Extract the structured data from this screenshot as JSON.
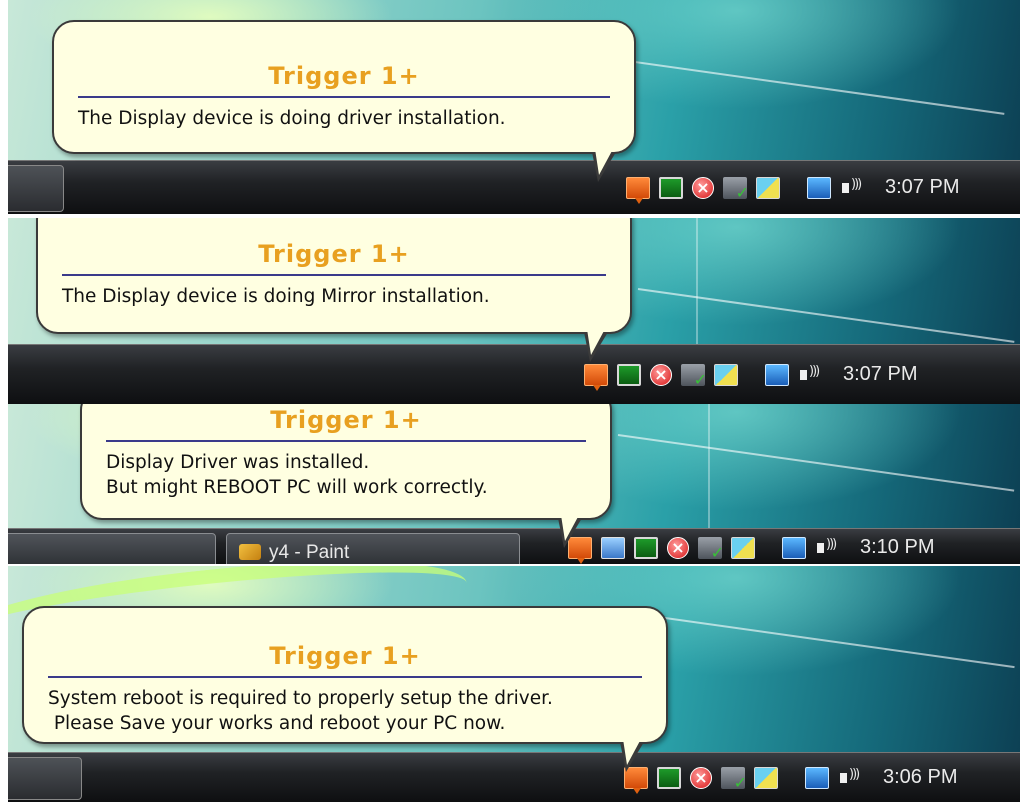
{
  "panels": [
    {
      "balloon": {
        "title": "Trigger 1+",
        "message": "The Display device is doing driver installation."
      },
      "taskbar": {
        "clock": "3:07 PM"
      }
    },
    {
      "balloon": {
        "title": "Trigger 1+",
        "message": "The Display device is doing Mirror installation."
      },
      "taskbar": {
        "clock": "3:07 PM"
      }
    },
    {
      "balloon": {
        "title": "Trigger 1+",
        "message": "Display Driver was installed.\nBut might REBOOT PC will work correctly."
      },
      "taskbar": {
        "clock": "3:10 PM",
        "task_button": "y4 - Paint"
      }
    },
    {
      "balloon": {
        "title": "Trigger 1+",
        "message": "System reboot is required to properly setup the driver.\n Please Save your works and reboot your PC now."
      },
      "taskbar": {
        "clock": "3:06 PM"
      }
    }
  ],
  "tray_icons": [
    "usb-display-icon",
    "monitor-icon",
    "security-shield-icon",
    "update-check-icon",
    "network-icon",
    "network-connection-icon",
    "volume-icon"
  ],
  "colors": {
    "balloon_bg": "#ffffe1",
    "title": "#e8a020",
    "rule": "#3a3a8a",
    "taskbar": "#1a1c1f"
  }
}
